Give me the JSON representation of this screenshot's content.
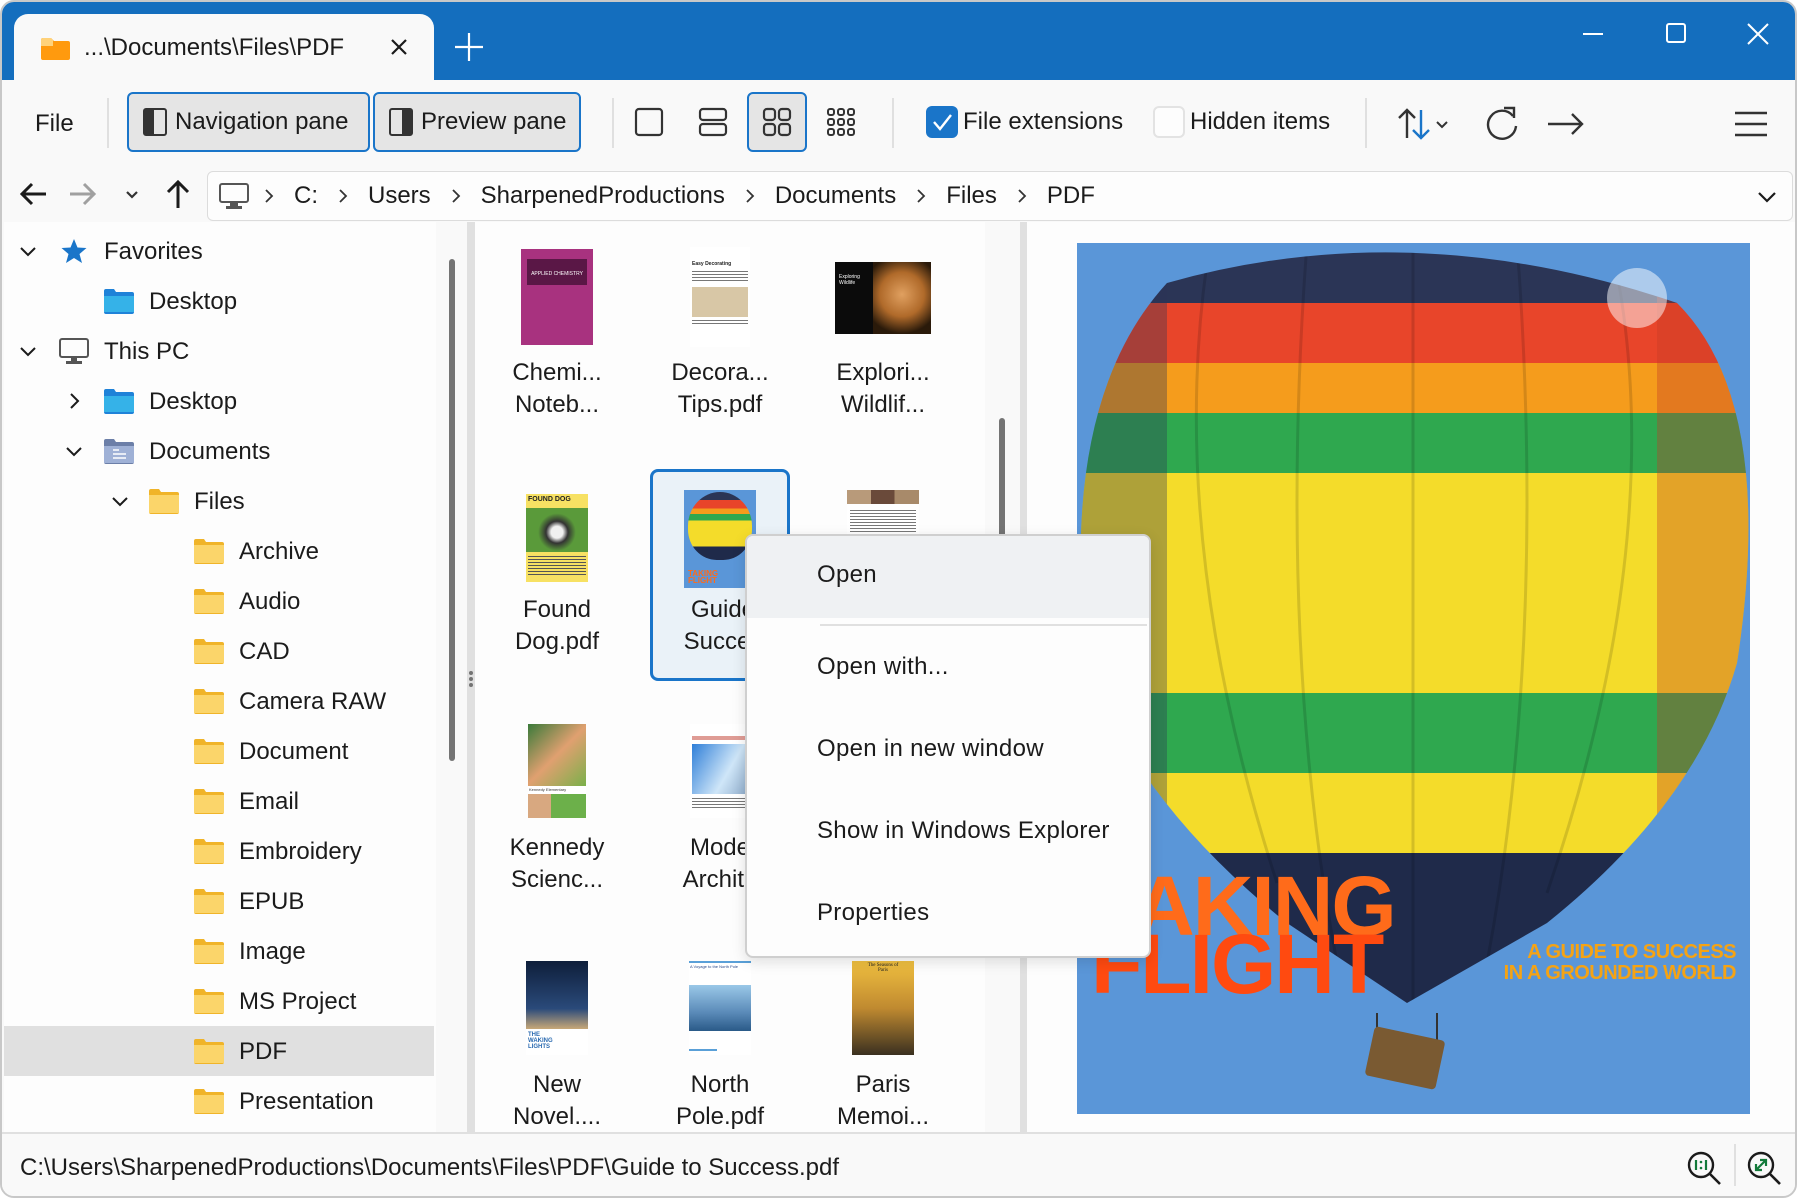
{
  "tab": {
    "title": "...\\Documents\\Files\\PDF",
    "close_icon": "close-icon",
    "new_tab_icon": "plus-icon"
  },
  "window_controls": {
    "minimize": "minimize-icon",
    "maximize": "maximize-icon",
    "close": "close-icon"
  },
  "toolbar": {
    "file_label": "File",
    "navigation_pane_label": "Navigation pane",
    "preview_pane_label": "Preview pane",
    "views": [
      {
        "name": "single-page-view",
        "selected": false
      },
      {
        "name": "list-view",
        "selected": false
      },
      {
        "name": "medium-icons-view",
        "selected": true
      },
      {
        "name": "small-icons-view",
        "selected": false
      }
    ],
    "file_extensions": {
      "label": "File extensions",
      "checked": true
    },
    "hidden_items": {
      "label": "Hidden items",
      "checked": false
    },
    "sort_icon": "sort-icon",
    "refresh_icon": "refresh-icon",
    "go_icon": "arrow-right-icon",
    "menu_icon": "hamburger-menu-icon"
  },
  "navigation": {
    "back_icon": "arrow-left-icon",
    "forward_icon": "arrow-right-icon",
    "recent_icon": "chevron-down-icon",
    "up_icon": "arrow-up-icon"
  },
  "address": {
    "root_icon": "computer-icon",
    "crumbs": [
      "C:",
      "Users",
      "SharpenedProductions",
      "Documents",
      "Files",
      "PDF"
    ]
  },
  "tree": [
    {
      "label": "Favorites",
      "level": 0,
      "chevron": "down",
      "icon": "star"
    },
    {
      "label": "Desktop",
      "level": 1,
      "chevron": "none",
      "icon": "desktop"
    },
    {
      "label": "This PC",
      "level": 0,
      "chevron": "down",
      "icon": "pc"
    },
    {
      "label": "Desktop",
      "level": 1,
      "chevron": "right",
      "icon": "desktop"
    },
    {
      "label": "Documents",
      "level": 1,
      "chevron": "down",
      "icon": "documents"
    },
    {
      "label": "Files",
      "level": 2,
      "chevron": "down",
      "icon": "folder"
    },
    {
      "label": "Archive",
      "level": 3,
      "chevron": "none",
      "icon": "folder"
    },
    {
      "label": "Audio",
      "level": 3,
      "chevron": "none",
      "icon": "folder"
    },
    {
      "label": "CAD",
      "level": 3,
      "chevron": "none",
      "icon": "folder"
    },
    {
      "label": "Camera RAW",
      "level": 3,
      "chevron": "none",
      "icon": "folder"
    },
    {
      "label": "Document",
      "level": 3,
      "chevron": "none",
      "icon": "folder"
    },
    {
      "label": "Email",
      "level": 3,
      "chevron": "none",
      "icon": "folder"
    },
    {
      "label": "Embroidery",
      "level": 3,
      "chevron": "none",
      "icon": "folder"
    },
    {
      "label": "EPUB",
      "level": 3,
      "chevron": "none",
      "icon": "folder"
    },
    {
      "label": "Image",
      "level": 3,
      "chevron": "none",
      "icon": "folder"
    },
    {
      "label": "MS Project",
      "level": 3,
      "chevron": "none",
      "icon": "folder"
    },
    {
      "label": "PDF",
      "level": 3,
      "chevron": "none",
      "icon": "folder",
      "selected": true
    },
    {
      "label": "Presentation",
      "level": 3,
      "chevron": "none",
      "icon": "folder"
    }
  ],
  "files": [
    {
      "line1": "Chemi...",
      "line2": "Noteb...",
      "thumb": "chemistry"
    },
    {
      "line1": "Decora...",
      "line2": "Tips.pdf",
      "thumb": "decorating"
    },
    {
      "line1": "Explori...",
      "line2": "Wildlif...",
      "thumb": "wildlife"
    },
    {
      "line1": "Found",
      "line2": "Dog.pdf",
      "thumb": "dog"
    },
    {
      "line1": "Guide",
      "line2": "Succes",
      "thumb": "balloon",
      "selected": true
    },
    {
      "line1": "",
      "line2": "",
      "thumb": "newsletter"
    },
    {
      "line1": "Kennedy",
      "line2": "Scienc...",
      "thumb": "science"
    },
    {
      "line1": "Mode",
      "line2": "Archite",
      "thumb": "architecture"
    },
    {
      "line1": "",
      "line2": "",
      "thumb": "hidden"
    },
    {
      "line1": "New",
      "line2": "Novel....",
      "thumb": "novel"
    },
    {
      "line1": "North",
      "line2": "Pole.pdf",
      "thumb": "northpole"
    },
    {
      "line1": "Paris",
      "line2": "Memoi...",
      "thumb": "paris"
    }
  ],
  "thumb_text": {
    "chemistry": "APPLIED CHEMISTRY",
    "decorating": "Easy Decorating",
    "wildlife": "Exploring Wildlife",
    "dog": "FOUND DOG",
    "science": "Kennedy Elementary",
    "novel": "THE WAKING LIGHTS",
    "northpole": "A Voyage to the North Pole",
    "paris": "The Seasons of Paris"
  },
  "preview": {
    "title_line1": "TAKING",
    "title_line2": "FLIGHT",
    "subtitle_line1": "A GUIDE TO SUCCESS",
    "subtitle_line2": "IN A GROUNDED WORLD"
  },
  "context_menu": {
    "items": [
      "Open",
      "Open with...",
      "Open in new window",
      "Show in Windows Explorer",
      "Properties"
    ],
    "hovered": "Open"
  },
  "status": {
    "path": "C:\\Users\\SharpenedProductions\\Documents\\Files\\PDF\\Guide to Success.pdf",
    "actual_size_icon": "zoom-actual-size-icon",
    "fit_icon": "zoom-fit-icon"
  },
  "colors": {
    "accent": "#1a75c9",
    "titlebar": "#146ebe",
    "folder": "#f8c94a"
  }
}
